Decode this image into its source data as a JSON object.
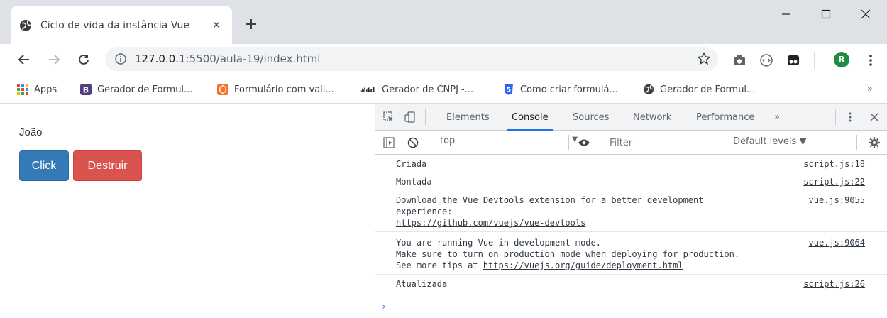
{
  "browser": {
    "tab_title": "Ciclo de vida da instância Vue",
    "url_host": "127.0.0.1",
    "url_path": ":5500/aula-19/index.html",
    "avatar_letter": "R"
  },
  "bookmarks": [
    {
      "label": "Apps",
      "icon": "apps-grid-icon"
    },
    {
      "label": "Gerador de Formul...",
      "icon": "bootstrap-icon"
    },
    {
      "label": "Formulário com vali...",
      "icon": "codepen-orange-icon"
    },
    {
      "label": "Gerador de CNPJ -...",
      "icon": "4devs-icon"
    },
    {
      "label": "Como criar formulá...",
      "icon": "html5-icon"
    },
    {
      "label": "Gerador de Formul...",
      "icon": "globe-icon"
    }
  ],
  "page": {
    "name": "João",
    "click_label": "Click",
    "destroy_label": "Destruir"
  },
  "devtools": {
    "tabs": [
      "Elements",
      "Console",
      "Sources",
      "Network",
      "Performance"
    ],
    "active_tab": "Console",
    "more": "»",
    "context": "top",
    "filter_placeholder": "Filter",
    "levels": "Default levels ▼",
    "messages": [
      {
        "text": "Criada",
        "source": "script.js:18"
      },
      {
        "text": "Montada",
        "source": "script.js:22"
      },
      {
        "line1": "Download the Vue Devtools extension for a better development",
        "line2": "experience:",
        "link": "https://github.com/vuejs/vue-devtools",
        "source": "vue.js:9055"
      },
      {
        "line1": "You are running Vue in development mode.",
        "line2": "Make sure to turn on production mode when deploying for production.",
        "line3_prefix": "See more tips at ",
        "link": "https://vuejs.org/guide/deployment.html",
        "source": "vue.js:9064"
      },
      {
        "text": "Atualizada",
        "source": "script.js:26"
      }
    ],
    "prompt": "›"
  },
  "colors": {
    "primary_button": "#337ab7",
    "danger_button": "#d9534f",
    "devtools_active": "#1a73e8",
    "avatar": "#1e8e3e"
  }
}
